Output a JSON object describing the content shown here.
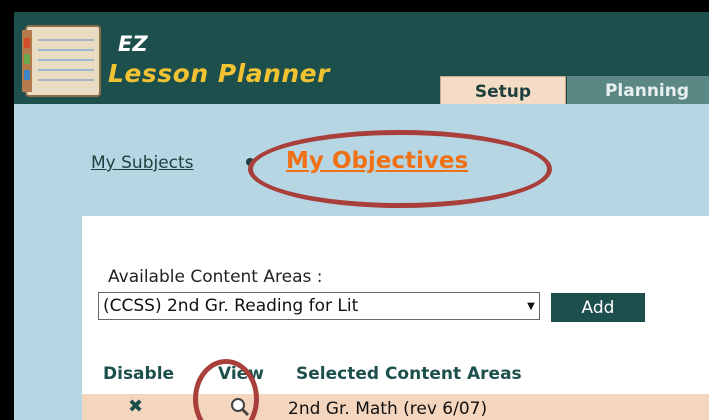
{
  "app": {
    "title_line1": "EZ",
    "title_line2": "Lesson Planner"
  },
  "tabs": [
    {
      "label": "Setup",
      "active": true
    },
    {
      "label": "Planning",
      "active": false
    }
  ],
  "breadcrumb": {
    "subjects": "My Subjects",
    "objectives": "My Objectives"
  },
  "content_areas": {
    "label": "Available Content Areas :",
    "selected_value": "(CCSS) 2nd Gr. Reading for Lit",
    "add_label": "Add"
  },
  "table": {
    "headers": [
      "Disable",
      "View",
      "Selected Content Areas"
    ],
    "rows": [
      {
        "disable_icon": "x-icon",
        "view_icon": "magnifier-icon",
        "area": "2nd Gr. Math (rev 6/07)"
      }
    ]
  },
  "colors": {
    "header_bg": "#1d4f4c",
    "title_yellow": "#f1c232",
    "content_bg": "#b6d6e3",
    "active_link": "#f07016",
    "row_bg": "#f4d6bf",
    "annotation_circle": "#a83f3b"
  }
}
